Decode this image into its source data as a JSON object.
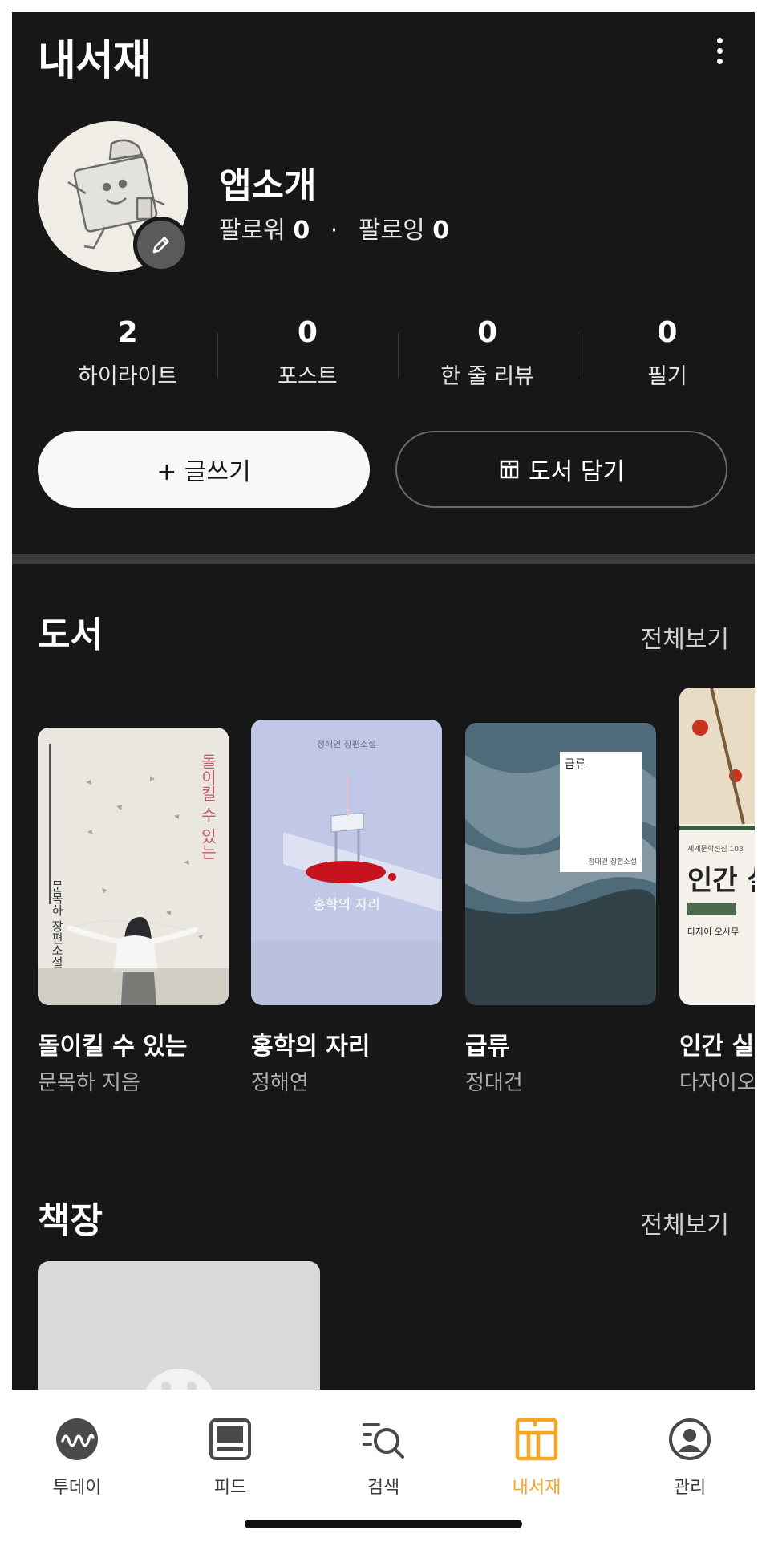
{
  "header": {
    "title": "내서재",
    "more_icon": "more-vertical-icon"
  },
  "profile": {
    "name": "앱소개",
    "followers_label": "팔로워",
    "followers_count": "0",
    "following_label": "팔로잉",
    "following_count": "0",
    "edit_icon": "pencil-icon"
  },
  "stats": [
    {
      "value": "2",
      "label": "하이라이트"
    },
    {
      "value": "0",
      "label": "포스트"
    },
    {
      "value": "0",
      "label": "한 줄 리뷰"
    },
    {
      "value": "0",
      "label": "필기"
    }
  ],
  "actions": {
    "write_label": "+ 글쓰기",
    "add_book_label": "도서 담기"
  },
  "books_section": {
    "title": "도서",
    "see_all": "전체보기",
    "items": [
      {
        "title": "돌이킬 수 있는",
        "author": "문목하 지음",
        "cover_text": "돌이킬 수 있는",
        "cover_side": "문목하 장편소설"
      },
      {
        "title": "홍학의 자리",
        "author": "정해연",
        "cover_text": "홍학의 자리",
        "cover_top": "정해연 장편소설"
      },
      {
        "title": "급류",
        "author": "정대건",
        "cover_text": "급류",
        "cover_sub": "정대건 장편소설"
      },
      {
        "title": "인간 실",
        "author": "다자이오",
        "cover_text": "인간 실",
        "cover_sub": "다자이 오사무"
      }
    ]
  },
  "shelf_section": {
    "title": "책장",
    "see_all": "전체보기"
  },
  "bottom_nav": {
    "active_color": "#f5a623",
    "items": [
      {
        "label": "투데이",
        "icon": "today-wave-icon"
      },
      {
        "label": "피드",
        "icon": "feed-icon"
      },
      {
        "label": "검색",
        "icon": "search-list-icon"
      },
      {
        "label": "내서재",
        "icon": "library-icon",
        "active": true
      },
      {
        "label": "관리",
        "icon": "profile-icon"
      }
    ]
  }
}
